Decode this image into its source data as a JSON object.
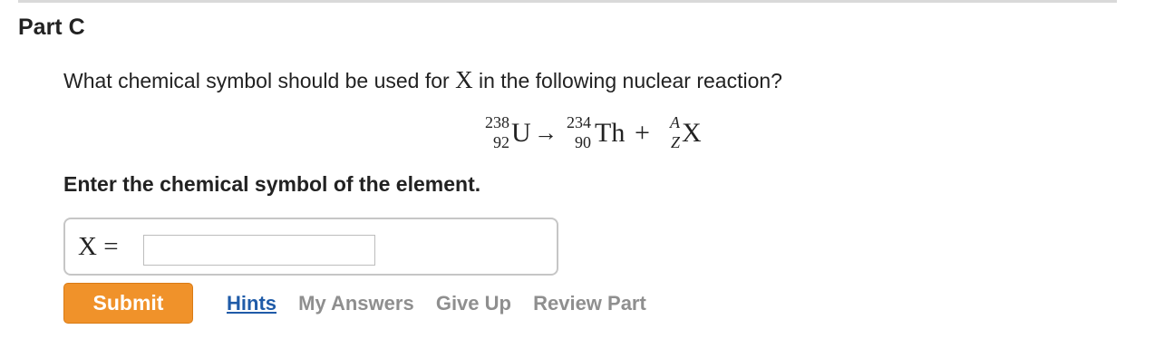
{
  "part": {
    "title": "Part C"
  },
  "question": {
    "text_before": "What chemical symbol should be used for ",
    "variable": "X",
    "text_after": " in the following nuclear reaction?"
  },
  "equation": {
    "reactant": {
      "mass": "238",
      "atomic": "92",
      "symbol": "U"
    },
    "arrow": "→",
    "product1": {
      "mass": "234",
      "atomic": "90",
      "symbol": "Th"
    },
    "plus": "+",
    "product2": {
      "mass": "A",
      "atomic": "Z",
      "symbol": "X"
    }
  },
  "instruction": "Enter the chemical symbol of the element.",
  "answer": {
    "label": "X =",
    "value": "",
    "placeholder": ""
  },
  "actions": {
    "submit_label": "Submit",
    "hints_label": "Hints",
    "my_answers_label": "My Answers",
    "give_up_label": "Give Up",
    "review_part_label": "Review Part"
  },
  "colors": {
    "submit_bg": "#f0922a",
    "link_active": "#1f5ba8",
    "link_disabled": "#8f8f8f"
  }
}
